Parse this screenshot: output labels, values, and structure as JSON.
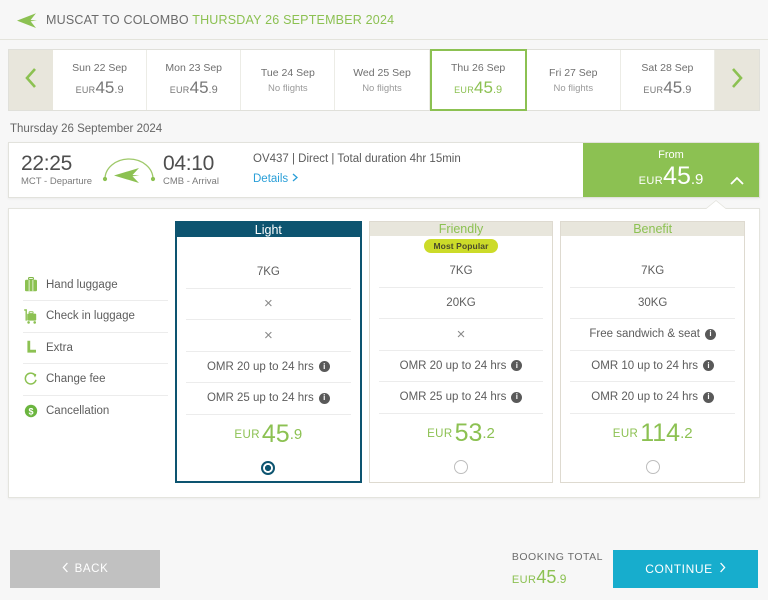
{
  "header": {
    "plane_icon": "airplane-icon",
    "route": "MUSCAT TO COLOMBO",
    "date": "THURSDAY 26 SEPTEMBER 2024"
  },
  "date_strip": {
    "prev_icon": "chevron-left-icon",
    "next_icon": "chevron-right-icon",
    "no_flights_label": "No flights",
    "currency": "EUR",
    "days": [
      {
        "day": "Sun 22 Sep",
        "has_flight": true,
        "whole": "45",
        "dec": ".9",
        "selected": false
      },
      {
        "day": "Mon 23 Sep",
        "has_flight": true,
        "whole": "45",
        "dec": ".9",
        "selected": false
      },
      {
        "day": "Tue 24 Sep",
        "has_flight": false,
        "selected": false
      },
      {
        "day": "Wed 25 Sep",
        "has_flight": false,
        "selected": false
      },
      {
        "day": "Thu 26 Sep",
        "has_flight": true,
        "whole": "45",
        "dec": ".9",
        "selected": true
      },
      {
        "day": "Fri 27 Sep",
        "has_flight": false,
        "selected": false
      },
      {
        "day": "Sat 28 Sep",
        "has_flight": true,
        "whole": "45",
        "dec": ".9",
        "selected": false
      }
    ]
  },
  "day_label": "Thursday 26 September 2024",
  "flight": {
    "depart_time": "22:25",
    "depart_sub": "MCT - Departure",
    "arrive_time": "04:10",
    "arrive_sub": "CMB - Arrival",
    "route_icon": "flight-arc-icon",
    "meta": "OV437 | Direct | Total duration 4hr 15min",
    "details_label": "Details",
    "details_chevron": "chevron-right-icon",
    "price_from_label": "From",
    "price_currency": "EUR",
    "price_whole": "45",
    "price_dec": ".9",
    "collapse_icon": "chevron-up-icon"
  },
  "amenities": [
    {
      "label": "Hand luggage",
      "icon": "suitcase-icon"
    },
    {
      "label": "Check in luggage",
      "icon": "luggage-cart-icon"
    },
    {
      "label": "Extra",
      "icon": "seat-icon"
    },
    {
      "label": "Change fee",
      "icon": "refresh-circle-icon"
    },
    {
      "label": "Cancellation",
      "icon": "dollar-circle-icon"
    }
  ],
  "fares": [
    {
      "name": "Light",
      "badge": null,
      "primary": true,
      "selected": true,
      "cells": [
        {
          "text": "7KG",
          "info": false
        },
        {
          "text": "×",
          "cross": true,
          "info": false
        },
        {
          "text": "×",
          "cross": true,
          "info": false
        },
        {
          "text": "OMR 20 up to 24 hrs",
          "info": true
        },
        {
          "text": "OMR 25 up to 24 hrs",
          "info": true
        }
      ],
      "currency": "EUR",
      "price_whole": "45",
      "price_dec": ".9"
    },
    {
      "name": "Friendly",
      "badge": "Most Popular",
      "primary": false,
      "selected": false,
      "cells": [
        {
          "text": "7KG",
          "info": false
        },
        {
          "text": "20KG",
          "info": false
        },
        {
          "text": "×",
          "cross": true,
          "info": false
        },
        {
          "text": "OMR 20 up to 24 hrs",
          "info": true
        },
        {
          "text": "OMR 25 up to 24 hrs",
          "info": true
        }
      ],
      "currency": "EUR",
      "price_whole": "53",
      "price_dec": ".2"
    },
    {
      "name": "Benefit",
      "badge": null,
      "primary": false,
      "selected": false,
      "cells": [
        {
          "text": "7KG",
          "info": false
        },
        {
          "text": "30KG",
          "info": false
        },
        {
          "text": "Free sandwich & seat",
          "info": true
        },
        {
          "text": "OMR 10 up to 24 hrs",
          "info": true
        },
        {
          "text": "OMR 20 up to 24 hrs",
          "info": true
        }
      ],
      "currency": "EUR",
      "price_whole": "114",
      "price_dec": ".2"
    }
  ],
  "footer": {
    "back_label": "BACK",
    "back_chevron": "chevron-left-icon",
    "booking_total_label": "BOOKING TOTAL",
    "booking_currency": "EUR",
    "booking_whole": "45",
    "booking_dec": ".9",
    "continue_label": "CONTINUE",
    "continue_chevron": "chevron-right-icon"
  },
  "info_glyph": "i",
  "colors": {
    "green": "#8cc152",
    "teal": "#0d5470",
    "cyan": "#17adcd",
    "beige": "#e8e6dc",
    "badge": "#ccdb29",
    "link": "#2a9fd8"
  }
}
